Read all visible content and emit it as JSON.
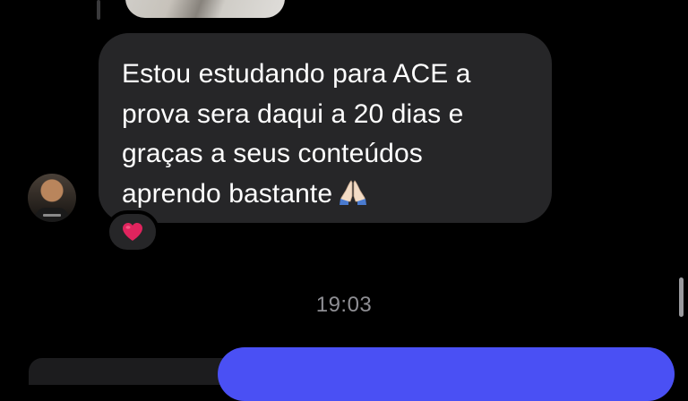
{
  "thread": {
    "previous_image_alt": "attached photo",
    "incoming_message": {
      "lines": [
        "Estou estudando para ACE a",
        "prova sera daqui a 20 dias e",
        "graças a seus conteúdos",
        "aprendo bastante"
      ],
      "emoji_icon": "folded-hands-icon",
      "reaction_icon": "red-heart-icon"
    },
    "timestamp": "19:03"
  },
  "colors": {
    "background": "#000000",
    "incoming_bubble": "#262628",
    "outgoing_bubble": "#4a50f4",
    "timestamp_text": "#8e8e93",
    "heart": "#e0245e"
  }
}
